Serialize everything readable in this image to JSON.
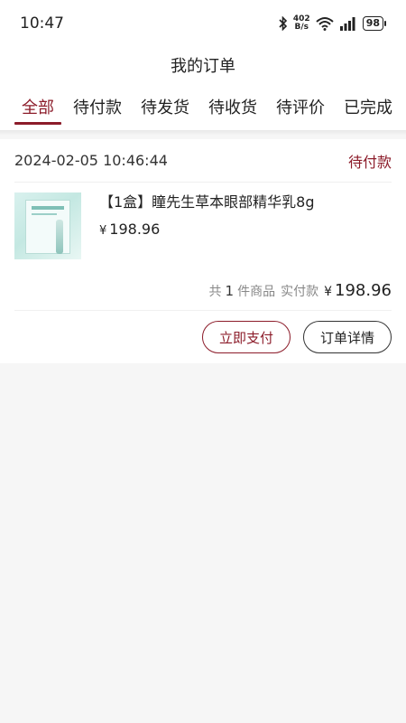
{
  "status_bar": {
    "time": "10:47",
    "net_speed_value": "402",
    "net_speed_unit": "B/s",
    "battery": "98",
    "icons": [
      "bluetooth-icon",
      "wifi-icon",
      "signal-icon",
      "battery-icon"
    ]
  },
  "header": {
    "title": "我的订单"
  },
  "tabs": [
    {
      "label": "全部",
      "active": true
    },
    {
      "label": "待付款",
      "active": false
    },
    {
      "label": "待发货",
      "active": false
    },
    {
      "label": "待收货",
      "active": false
    },
    {
      "label": "待评价",
      "active": false
    },
    {
      "label": "已完成",
      "active": false
    }
  ],
  "order": {
    "time": "2024-02-05 10:46:44",
    "status": "待付款",
    "item": {
      "name": "【1盒】瞳先生草本眼部精华乳8g",
      "currency": "¥",
      "price": "198.96"
    },
    "summary": {
      "prefix": "共",
      "count": "1",
      "suffix": "件商品",
      "paid_label": "实付款",
      "currency": "¥",
      "total": "198.96"
    },
    "buttons": {
      "pay": "立即支付",
      "detail": "订单详情"
    }
  },
  "colors": {
    "accent": "#8c1c2a",
    "background": "#f6f6f6"
  }
}
